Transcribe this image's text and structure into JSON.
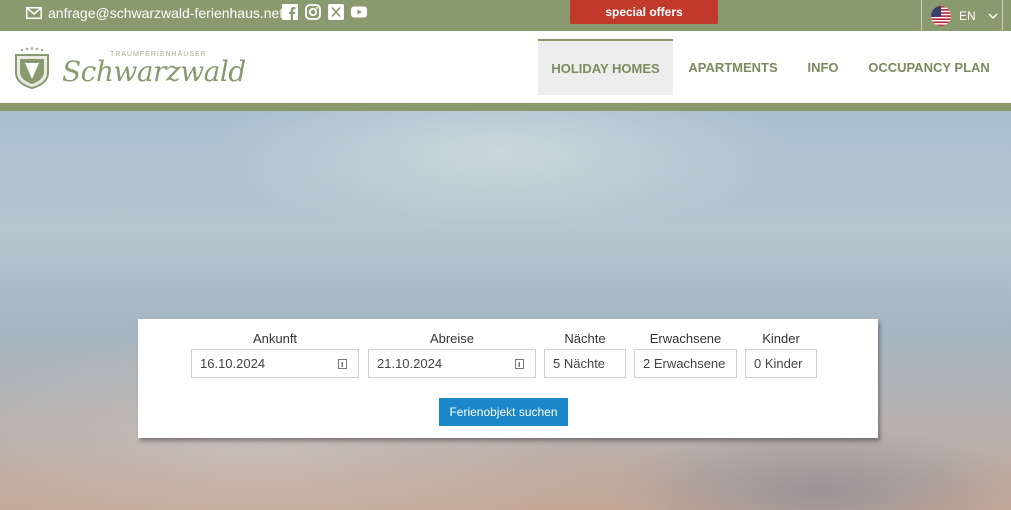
{
  "topbar": {
    "email": "anfrage@schwarzwald-ferienhaus.net",
    "socials": [
      "facebook-icon",
      "instagram-icon",
      "x-icon",
      "youtube-icon"
    ],
    "offers_label": "special offers",
    "language": "EN"
  },
  "logo": {
    "tagline": "TRAUMFERIENHÄUSER",
    "brand": "Schwarzwald"
  },
  "nav": {
    "items": [
      "HOLIDAY HOMES",
      "APARTMENTS",
      "INFO",
      "OCCUPANCY PLAN"
    ],
    "active": "HOLIDAY HOMES"
  },
  "search": {
    "arrival_label": "Ankunft",
    "arrival_value": "16.10.2024",
    "departure_label": "Abreise",
    "departure_value": "21.10.2024",
    "nights_label": "Nächte",
    "nights_value": "5 Nächte",
    "adults_label": "Erwachsene",
    "adults_value": "2 Erwachsene",
    "children_label": "Kinder",
    "children_value": "0 Kinder",
    "submit_label": "Ferienobjekt suchen"
  },
  "colors": {
    "brand_green": "#8a9a6f",
    "offers_red": "#c0392b",
    "button_blue": "#1a87c9"
  }
}
